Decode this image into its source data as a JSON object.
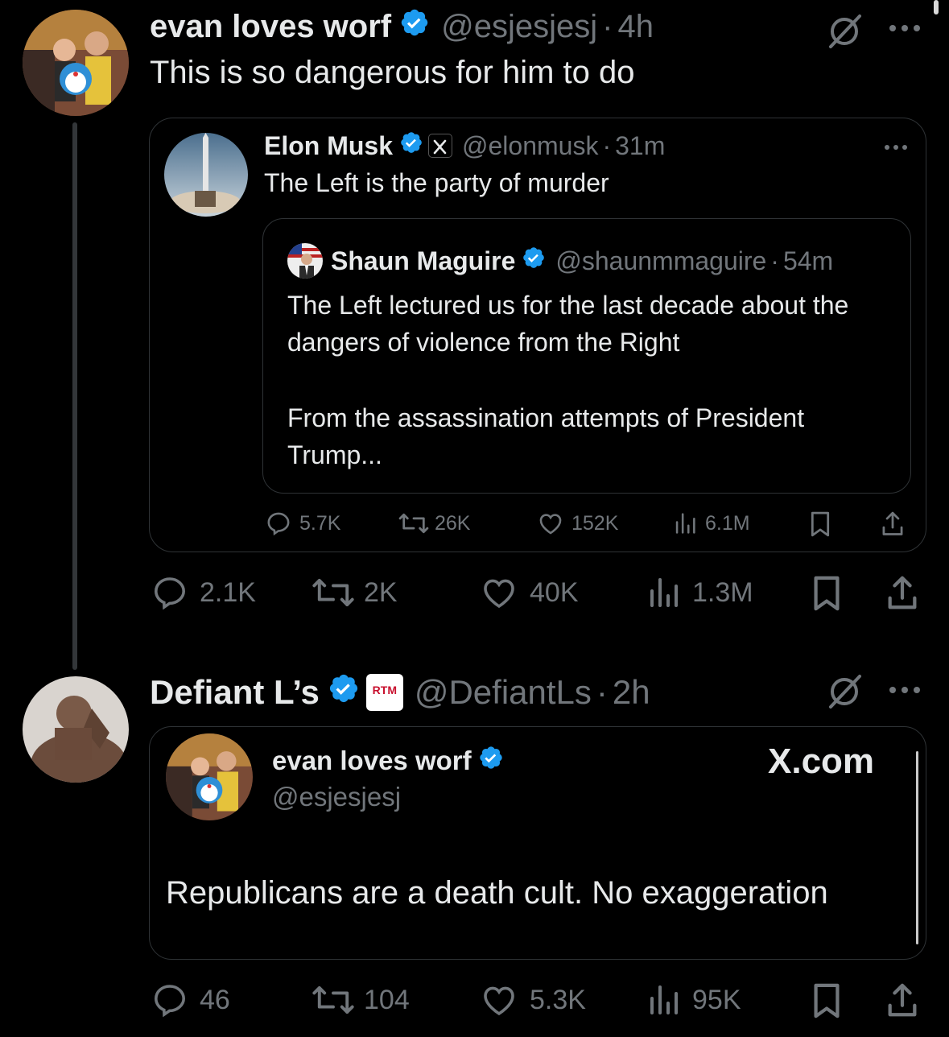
{
  "post1": {
    "display_name": "evan loves worf",
    "handle": "@esjesjesj",
    "time": "4h",
    "text": "This is so dangerous for him to do",
    "quote": {
      "display_name": "Elon Musk",
      "handle": "@elonmusk",
      "time": "31m",
      "text": "The Left is the party of murder",
      "nested_quote": {
        "display_name": "Shaun Maguire",
        "handle": "@shaunmmaguire",
        "time": "54m",
        "text_p1": "The Left lectured us for the last decade about the dangers of violence from the Right",
        "text_p2": "From the assassination attempts of President Trump..."
      },
      "stats": {
        "replies": "5.7K",
        "reposts": "26K",
        "likes": "152K",
        "views": "6.1M"
      }
    },
    "stats": {
      "replies": "2.1K",
      "reposts": "2K",
      "likes": "40K",
      "views": "1.3M"
    }
  },
  "post2": {
    "display_name": "Defiant L’s",
    "affiliate_badge": "RTM",
    "handle": "@DefiantLs",
    "time": "2h",
    "embed": {
      "display_name": "evan loves worf",
      "handle": "@esjesjesj",
      "watermark": "X.com",
      "text": "Republicans are a death cult. No exaggeration"
    },
    "stats": {
      "replies": "46",
      "reposts": "104",
      "likes": "5.3K",
      "views": "95K"
    }
  },
  "colors": {
    "verified": "#1d9bf0",
    "muted": "#71767b",
    "border": "#2f3336",
    "background": "#000000"
  }
}
